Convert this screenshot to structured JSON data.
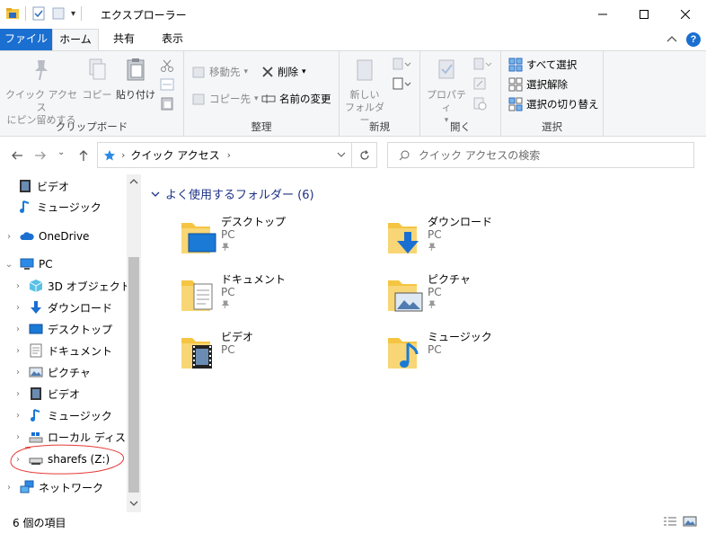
{
  "window": {
    "title": "エクスプローラー",
    "minimize_label": "─",
    "maximize_label": "☐",
    "close_label": "✕"
  },
  "tabs": {
    "file": "ファイル",
    "home": "ホーム",
    "share": "共有",
    "view": "表示"
  },
  "ribbon": {
    "clipboard": {
      "label": "クリップボード",
      "pin_line1": "クイック アクセス",
      "pin_line2": "にピン留めする",
      "copy": "コピー",
      "paste": "貼り付け"
    },
    "organize": {
      "label": "整理",
      "move_to": "移動先",
      "copy_to": "コピー先",
      "delete": "削除",
      "rename": "名前の変更"
    },
    "new": {
      "label": "新規",
      "new_folder_line1": "新しい",
      "new_folder_line2": "フォルダー"
    },
    "open": {
      "label": "開く",
      "properties": "プロパティ"
    },
    "select": {
      "label": "選択",
      "select_all": "すべて選択",
      "select_none": "選択解除",
      "invert": "選択の切り替え"
    }
  },
  "address": {
    "location": "クイック アクセス",
    "search_placeholder": "クイック アクセスの検索"
  },
  "sidebar": {
    "items": [
      {
        "label": "ビデオ",
        "icon": "video-icon"
      },
      {
        "label": "ミュージック",
        "icon": "music-icon"
      },
      {
        "label": "OneDrive",
        "icon": "cloud-icon"
      },
      {
        "label": "PC",
        "icon": "pc-icon"
      },
      {
        "label": "3D オブジェクト",
        "icon": "3d-icon"
      },
      {
        "label": "ダウンロード",
        "icon": "download-icon"
      },
      {
        "label": "デスクトップ",
        "icon": "desktop-icon"
      },
      {
        "label": "ドキュメント",
        "icon": "document-icon"
      },
      {
        "label": "ピクチャ",
        "icon": "picture-icon"
      },
      {
        "label": "ビデオ",
        "icon": "video-icon"
      },
      {
        "label": "ミュージック",
        "icon": "music-icon"
      },
      {
        "label": "ローカル ディスク (C",
        "icon": "drive-icon"
      },
      {
        "label": "sharefs (Z:)",
        "icon": "network-drive-icon"
      },
      {
        "label": "ネットワーク",
        "icon": "network-icon"
      }
    ]
  },
  "main": {
    "section_title": "よく使用するフォルダー (6)",
    "folders": [
      {
        "name": "デスクトップ",
        "location": "PC",
        "pinned": true
      },
      {
        "name": "ダウンロード",
        "location": "PC",
        "pinned": true
      },
      {
        "name": "ドキュメント",
        "location": "PC",
        "pinned": true
      },
      {
        "name": "ピクチャ",
        "location": "PC",
        "pinned": true
      },
      {
        "name": "ビデオ",
        "location": "PC",
        "pinned": false
      },
      {
        "name": "ミュージック",
        "location": "PC",
        "pinned": false
      }
    ]
  },
  "status": {
    "item_count": "6 個の項目"
  },
  "colors": {
    "accent": "#1a6fd1",
    "folder": "#f5c542",
    "annotation": "#e53935"
  }
}
